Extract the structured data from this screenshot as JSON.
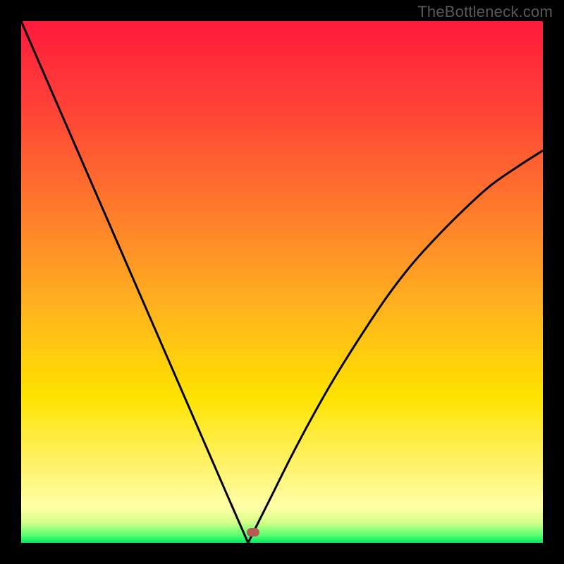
{
  "watermark": "TheBottleneck.com",
  "colors": {
    "frame_bg": "#000000",
    "curve": "#000000",
    "marker": "#b65a52",
    "gradient_stops": [
      {
        "offset": 0.0,
        "color": "#ff1a3c"
      },
      {
        "offset": 0.18,
        "color": "#ff4636"
      },
      {
        "offset": 0.36,
        "color": "#ff7a2c"
      },
      {
        "offset": 0.54,
        "color": "#ffb020"
      },
      {
        "offset": 0.72,
        "color": "#ffe300"
      },
      {
        "offset": 0.85,
        "color": "#fff26a"
      },
      {
        "offset": 0.93,
        "color": "#ffffa8"
      },
      {
        "offset": 0.96,
        "color": "#d7ff8a"
      },
      {
        "offset": 0.985,
        "color": "#5cff72"
      },
      {
        "offset": 1.0,
        "color": "#00e85a"
      }
    ]
  },
  "chart_data": {
    "type": "line",
    "title": "",
    "xlabel": "",
    "ylabel": "",
    "xlim": [
      0,
      1
    ],
    "ylim": [
      0,
      1
    ],
    "grid": false,
    "series": [
      {
        "name": "bottleneck-curve",
        "x": [
          0.0,
          0.05,
          0.1,
          0.15,
          0.2,
          0.25,
          0.3,
          0.35,
          0.4,
          0.435,
          0.45,
          0.48,
          0.52,
          0.56,
          0.6,
          0.65,
          0.7,
          0.75,
          0.8,
          0.85,
          0.9,
          0.95,
          1.0
        ],
        "y": [
          1.0,
          0.885,
          0.77,
          0.655,
          0.54,
          0.425,
          0.31,
          0.195,
          0.08,
          0.0,
          0.03,
          0.09,
          0.17,
          0.245,
          0.315,
          0.395,
          0.47,
          0.535,
          0.59,
          0.64,
          0.685,
          0.72,
          0.752
        ]
      }
    ],
    "cusp": {
      "x": 0.435,
      "y": 0.0
    },
    "marker": {
      "x": 0.445,
      "y": 0.02
    }
  }
}
